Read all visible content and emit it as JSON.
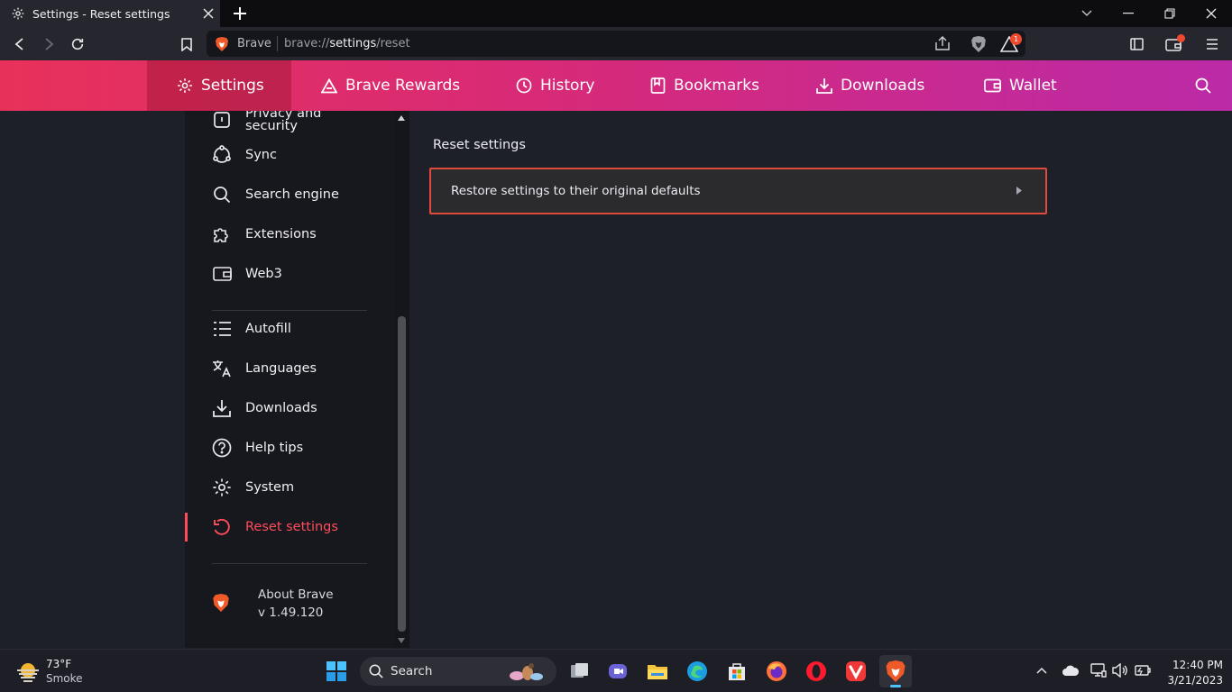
{
  "browser": {
    "tab_title": "Settings - Reset settings",
    "omnibox_brand": "Brave",
    "url_prefix": "brave://",
    "url_highlight": "settings",
    "url_suffix": "/reset",
    "notification_count": "1"
  },
  "nav": {
    "items": [
      {
        "label": "Settings",
        "icon": "gear-icon"
      },
      {
        "label": "Brave Rewards",
        "icon": "triangle-icon"
      },
      {
        "label": "History",
        "icon": "clock-icon"
      },
      {
        "label": "Bookmarks",
        "icon": "book-icon"
      },
      {
        "label": "Downloads",
        "icon": "download-icon"
      },
      {
        "label": "Wallet",
        "icon": "wallet-icon"
      }
    ]
  },
  "sidebar": {
    "partial_item": "Privacy and security",
    "items": [
      {
        "label": "Sync",
        "icon": "sync-icon"
      },
      {
        "label": "Search engine",
        "icon": "search-icon"
      },
      {
        "label": "Extensions",
        "icon": "puzzle-icon"
      },
      {
        "label": "Web3",
        "icon": "wallet-icon"
      },
      {
        "label": "Autofill",
        "icon": "list-icon"
      },
      {
        "label": "Languages",
        "icon": "translate-icon"
      },
      {
        "label": "Downloads",
        "icon": "download-icon"
      },
      {
        "label": "Help tips",
        "icon": "help-icon"
      },
      {
        "label": "System",
        "icon": "gear-icon"
      },
      {
        "label": "Reset settings",
        "icon": "reset-icon"
      }
    ],
    "about_title": "About Brave",
    "about_version": "v 1.49.120",
    "active_color": "#ff4c5b"
  },
  "main": {
    "section_title": "Reset settings",
    "restore_label": "Restore settings to their original defaults"
  },
  "taskbar": {
    "weather_temp": "73°F",
    "weather_desc": "Smoke",
    "search_label": "Search",
    "time": "12:40 PM",
    "date": "3/21/2023"
  }
}
